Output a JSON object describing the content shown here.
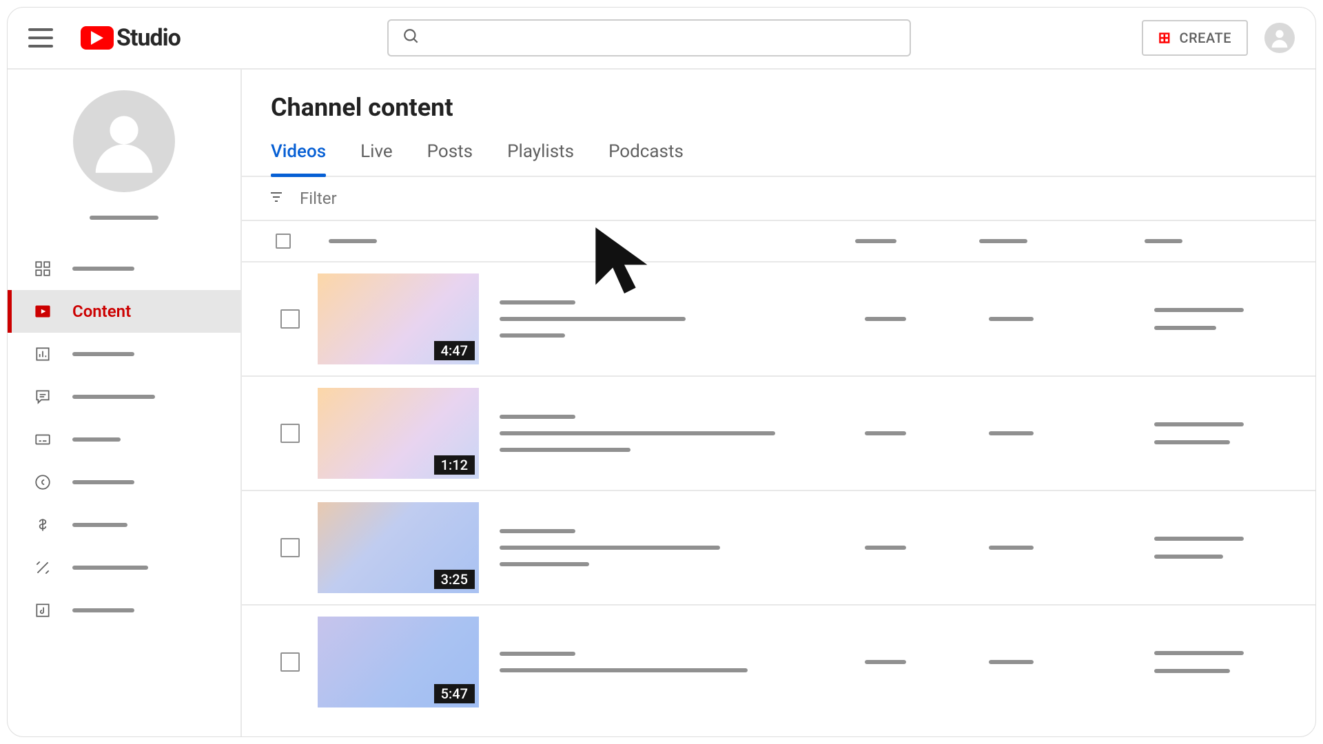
{
  "header": {
    "logo_text": "Studio",
    "create_label": "CREATE",
    "search_placeholder": ""
  },
  "page": {
    "title": "Channel content"
  },
  "tabs": [
    {
      "label": "Videos",
      "active": true
    },
    {
      "label": "Live",
      "active": false
    },
    {
      "label": "Posts",
      "active": false
    },
    {
      "label": "Playlists",
      "active": false
    },
    {
      "label": "Podcasts",
      "active": false
    }
  ],
  "filter": {
    "placeholder": "Filter"
  },
  "sidebar": {
    "items": [
      {
        "id": "dashboard",
        "active": false
      },
      {
        "id": "content",
        "label": "Content",
        "active": true
      },
      {
        "id": "analytics",
        "active": false
      },
      {
        "id": "comments",
        "active": false
      },
      {
        "id": "subtitles",
        "active": false
      },
      {
        "id": "copyright",
        "active": false
      },
      {
        "id": "earn",
        "active": false
      },
      {
        "id": "customize",
        "active": false
      },
      {
        "id": "audio",
        "active": false
      }
    ]
  },
  "videos": [
    {
      "duration": "4:47",
      "thumb_variant": "warm"
    },
    {
      "duration": "1:12",
      "thumb_variant": "warm"
    },
    {
      "duration": "3:25",
      "thumb_variant": "blue"
    },
    {
      "duration": "5:47",
      "thumb_variant": "blue2"
    }
  ]
}
